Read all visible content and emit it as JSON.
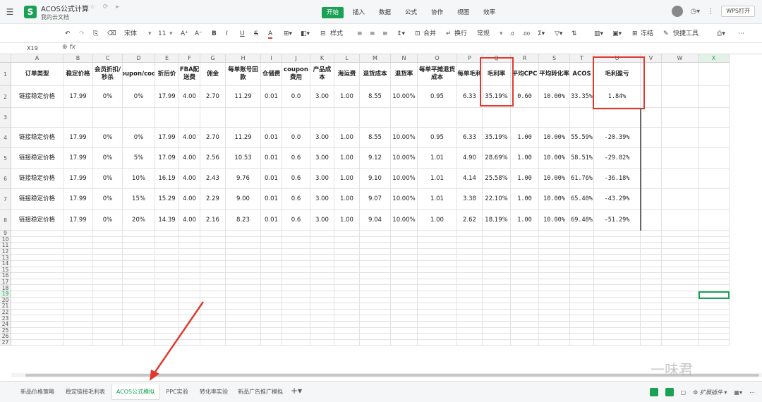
{
  "app": {
    "title": "ACOS公式计算",
    "location": "我的云文档",
    "logo_letter": "S",
    "open_button": "WPS打开"
  },
  "menu_tabs": [
    {
      "label": "开始",
      "active": true
    },
    {
      "label": "插入",
      "active": false
    },
    {
      "label": "数据",
      "active": false
    },
    {
      "label": "公式",
      "active": false
    },
    {
      "label": "协作",
      "active": false
    },
    {
      "label": "视图",
      "active": false
    },
    {
      "label": "效率",
      "active": false
    }
  ],
  "toolbar": {
    "font_name": "宋体",
    "font_size": "11",
    "style_label": "样式",
    "merge_label": "合并",
    "wrap_label": "换行",
    "format_label": "常规",
    "freeze_label": "冻结",
    "quick_tools": "快捷工具"
  },
  "formula_bar": {
    "name_box": "X19",
    "fx": "fx"
  },
  "columns": [
    "A",
    "B",
    "C",
    "D",
    "E",
    "F",
    "G",
    "H",
    "I",
    "J",
    "K",
    "L",
    "M",
    "N",
    "O",
    "P",
    "Q",
    "R",
    "S",
    "T",
    "U",
    "V",
    "W",
    "X"
  ],
  "header_row": [
    "订单类型",
    "稳定价格",
    "会员折扣/秒杀",
    "coupon/code",
    "折后价",
    "FBA配送费",
    "佣金",
    "每单账号回款",
    "仓储费",
    "coupon费用",
    "产品成本",
    "海运费",
    "退货成本",
    "退货率",
    "每单平摊退货成本",
    "每单毛利",
    "毛利率",
    "平均CPC",
    "平均转化率",
    "ACOS",
    "毛利盈亏"
  ],
  "data_rows": [
    {
      "row": 2,
      "cells": [
        "链接稳定价格",
        "17.99",
        "0%",
        "0%",
        "17.99",
        "4.00",
        "2.70",
        "11.29",
        "0.01",
        "0.0",
        "3.00",
        "1.00",
        "8.55",
        "10.00%",
        "0.95",
        "6.33",
        "35.19%",
        "0.60",
        "10.00%",
        "33.35%",
        "1.84%"
      ]
    },
    {
      "row": 4,
      "cells": [
        "链接稳定价格",
        "17.99",
        "0%",
        "0%",
        "17.99",
        "4.00",
        "2.70",
        "11.29",
        "0.01",
        "0.0",
        "3.00",
        "1.00",
        "8.55",
        "10.00%",
        "0.95",
        "6.33",
        "35.19%",
        "1.00",
        "10.00%",
        "55.59%",
        "-20.39%"
      ]
    },
    {
      "row": 5,
      "cells": [
        "链接稳定价格",
        "17.99",
        "0%",
        "5%",
        "17.09",
        "4.00",
        "2.56",
        "10.53",
        "0.01",
        "0.6",
        "3.00",
        "1.00",
        "9.12",
        "10.00%",
        "1.01",
        "4.90",
        "28.69%",
        "1.00",
        "10.00%",
        "58.51%",
        "-29.82%"
      ]
    },
    {
      "row": 6,
      "cells": [
        "链接稳定价格",
        "17.99",
        "0%",
        "10%",
        "16.19",
        "4.00",
        "2.43",
        "9.76",
        "0.01",
        "0.6",
        "3.00",
        "1.00",
        "9.10",
        "10.00%",
        "1.01",
        "4.14",
        "25.58%",
        "1.00",
        "10.00%",
        "61.76%",
        "-36.18%"
      ]
    },
    {
      "row": 7,
      "cells": [
        "链接稳定价格",
        "17.99",
        "0%",
        "15%",
        "15.29",
        "4.00",
        "2.29",
        "9.00",
        "0.01",
        "0.6",
        "3.00",
        "1.00",
        "9.07",
        "10.00%",
        "1.01",
        "3.38",
        "22.10%",
        "1.00",
        "10.00%",
        "65.40%",
        "-43.29%"
      ]
    },
    {
      "row": 8,
      "cells": [
        "链接稳定价格",
        "17.99",
        "0%",
        "20%",
        "14.39",
        "4.00",
        "2.16",
        "8.23",
        "0.01",
        "0.6",
        "3.00",
        "1.00",
        "9.04",
        "10.00%",
        "1.00",
        "2.62",
        "18.19%",
        "1.00",
        "10.00%",
        "69.48%",
        "-51.29%"
      ]
    }
  ],
  "row_numbers": [
    "1",
    "2",
    "3",
    "4",
    "5",
    "6",
    "7",
    "8",
    "9",
    "10",
    "11",
    "12",
    "13",
    "14",
    "15",
    "16",
    "17",
    "18",
    "19",
    "20",
    "21",
    "22",
    "23",
    "24",
    "25",
    "26",
    "27"
  ],
  "sheets": [
    {
      "label": "新品价格策略",
      "active": false
    },
    {
      "label": "稳定链接毛利表",
      "active": false
    },
    {
      "label": "ACOS公式模拟",
      "active": true
    },
    {
      "label": "PPC实验",
      "active": false
    },
    {
      "label": "转化率实验",
      "active": false
    },
    {
      "label": "新品广告推广模拟",
      "active": false
    }
  ],
  "status": {
    "extensions": "扩展插件"
  },
  "watermark": "一味君",
  "colors": {
    "accent": "#1ba155",
    "highlight_box": "#e03a2f"
  }
}
